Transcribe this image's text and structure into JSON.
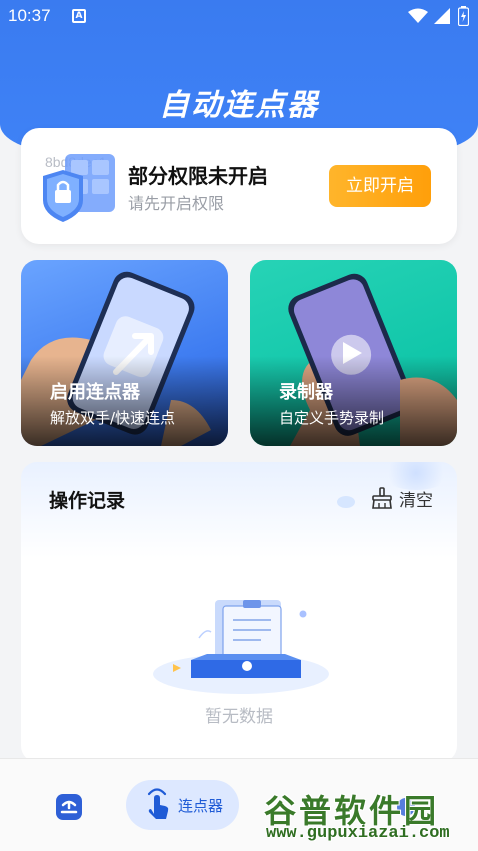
{
  "status_bar": {
    "time": "10:37",
    "notification_letter": "A"
  },
  "header": {
    "title": "自动连点器"
  },
  "permission": {
    "code_text": "8bd8dec1",
    "title": "部分权限未开启",
    "subtitle": "请先开启权限",
    "button_label": "立即开启"
  },
  "features": [
    {
      "title": "启用连点器",
      "subtitle": "解放双手/快速连点"
    },
    {
      "title": "录制器",
      "subtitle": "自定义手势录制"
    }
  ],
  "records": {
    "title": "操作记录",
    "clear_label": "清空",
    "empty_label": "暂无数据"
  },
  "tab_bar": {
    "active_label": "连点器"
  },
  "watermark": {
    "main": "谷普软件园",
    "url": "www.gupuxiazai.com"
  },
  "colors": {
    "primary": "#3f82f6",
    "accent_orange": "#ffa515",
    "green": "#12c7aa",
    "watermark_green": "#3a7a2a"
  },
  "icons": [
    "wifi-icon",
    "signal-icon",
    "battery-icon",
    "shield-lock-icon",
    "arrow-up-right-icon",
    "play-icon",
    "broom-icon",
    "home-icon",
    "tap-hand-icon"
  ]
}
